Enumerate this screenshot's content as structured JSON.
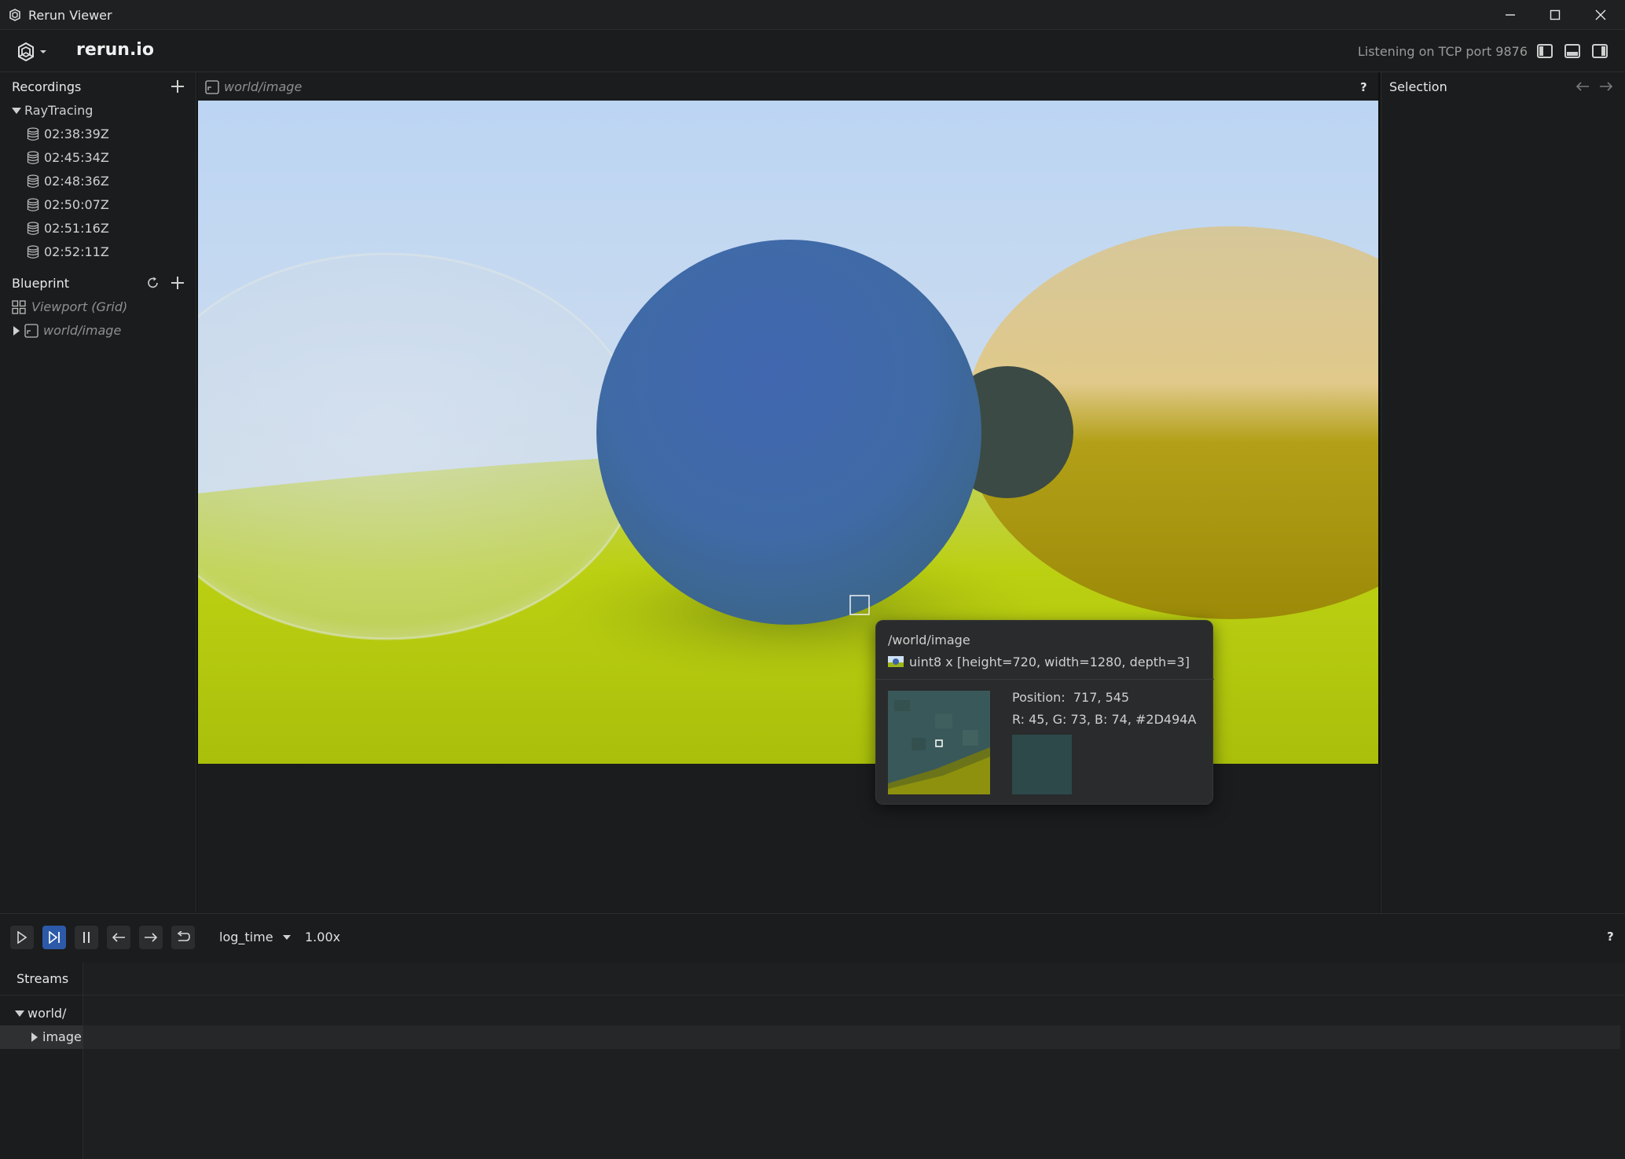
{
  "window": {
    "title": "Rerun Viewer",
    "controls": [
      "minimize",
      "maximize",
      "close"
    ]
  },
  "top_panel": {
    "brand": "rerun.io",
    "status": "Listening on TCP port 9876"
  },
  "recordings": {
    "header": "Recordings",
    "app_name": "RayTracing",
    "items": [
      "02:38:39Z",
      "02:45:34Z",
      "02:48:36Z",
      "02:50:07Z",
      "02:51:16Z",
      "02:52:11Z"
    ]
  },
  "blueprint": {
    "header": "Blueprint",
    "viewport_label": "Viewport (Grid)",
    "space_view_label": "world/image"
  },
  "space_view": {
    "title": "world/image",
    "help": "?"
  },
  "selection": {
    "header": "Selection"
  },
  "tooltip": {
    "entity_path": "/world/image",
    "tensor_info": "uint8 x [height=720, width=1280, depth=3]",
    "position_label": "Position:",
    "position_value": "717, 545",
    "rgb_text": "R: 45, G: 73, B: 74, #2D494A",
    "swatch_color": "#2D494A"
  },
  "time_panel": {
    "timeline": "log_time",
    "speed": "1.00x",
    "help": "?",
    "streams_header": "Streams",
    "tree": [
      {
        "label": "world/",
        "expanded": true
      },
      {
        "label": "image",
        "expanded": false
      }
    ]
  },
  "colors": {
    "accent": "#2c5aa8",
    "panel_bg": "#1b1c1d"
  }
}
